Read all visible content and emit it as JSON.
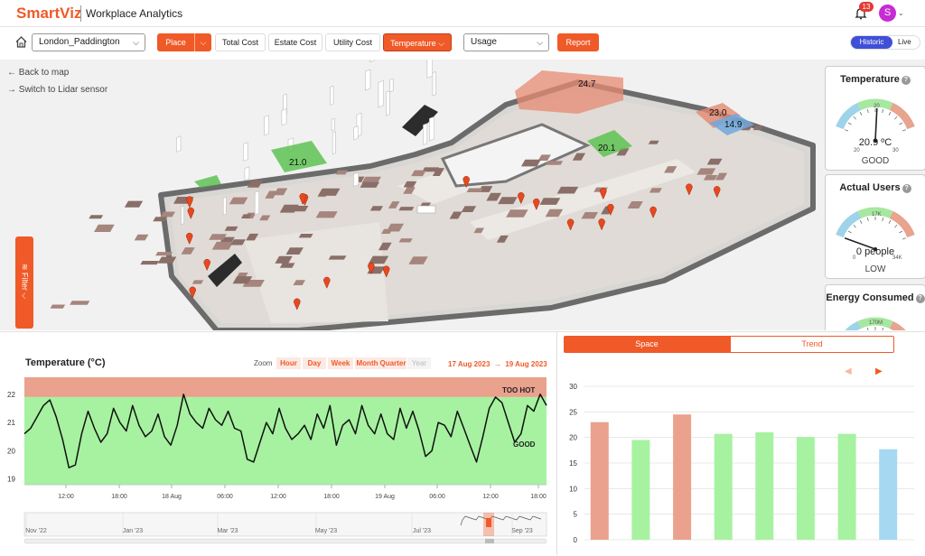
{
  "header": {
    "brand": "SmartViz",
    "product": "Workplace Analytics",
    "notifications": "13",
    "avatar": "S"
  },
  "toolbar": {
    "location": "London_Paddington",
    "place": "Place",
    "total_cost": "Total Cost",
    "estate_cost": "Estate Cost",
    "utility_cost": "Utility Cost",
    "temperature": "Temperature",
    "usage": "Usage",
    "report": "Report",
    "historic": "Historic",
    "live": "Live"
  },
  "map": {
    "back": "Back to map",
    "lidar": "Switch to Lidar sensor",
    "filter": "Filter",
    "zone_labels": [
      {
        "text": "21.0",
        "color": "#55c14a"
      },
      {
        "text": "20.1",
        "color": "#55c14a"
      },
      {
        "text": "24.7",
        "color": "#e58a71"
      },
      {
        "text": "23.0",
        "color": "#e58a71"
      },
      {
        "text": "14.9",
        "color": "#6fa8dc"
      }
    ]
  },
  "gauges": {
    "temperature": {
      "title": "Temperature",
      "value": "20.9 ºC",
      "status": "GOOD",
      "min": "20",
      "mid": "20",
      "max": "30",
      "fraction": 0.52
    },
    "users": {
      "title": "Actual Users",
      "value": "0 people",
      "status": "LOW",
      "min": "0",
      "mid": "17K",
      "max": "34K",
      "fraction": 0.0
    },
    "energy": {
      "title": "Energy Consumed",
      "mid": "170M"
    }
  },
  "temp_chart": {
    "title": "Temperature (°C)",
    "zoom_label": "Zoom",
    "zoom_options": [
      "Hour",
      "Day",
      "Week",
      "Month",
      "Quarter",
      "Year"
    ],
    "date_from": "17 Aug 2023",
    "arrow": "→",
    "date_to": "19 Aug 2023",
    "band_labels": {
      "hot": "TOO HOT",
      "good": "GOOD"
    },
    "navigator_labels": [
      "Nov '22",
      "Jan '23",
      "Mar '23",
      "May '23",
      "Jul '23",
      "Sep '23"
    ]
  },
  "space_card": {
    "tabs": {
      "space": "Space",
      "trend": "Trend"
    },
    "prev": "◀",
    "next": "▶"
  },
  "chart_data": [
    {
      "type": "line",
      "title": "Temperature (°C)",
      "ylim": [
        18.8,
        22.6
      ],
      "y_ticks": [
        19,
        20,
        21,
        22
      ],
      "x_ticks": [
        "12:00",
        "18:00",
        "18 Aug",
        "06:00",
        "12:00",
        "18:00",
        "19 Aug",
        "06:00",
        "12:00",
        "18:00"
      ],
      "bands": [
        {
          "label": "TOO HOT",
          "from": 21.9,
          "to": 22.6,
          "color": "#eaa18d"
        },
        {
          "label": "GOOD",
          "from": 18.8,
          "to": 21.9,
          "color": "#a6f2a0"
        }
      ],
      "series": [
        {
          "color": "#111111",
          "x": [
            0,
            0.6,
            1.2,
            1.8,
            2.4,
            3.0,
            3.6,
            4.2,
            4.8,
            5.4,
            6.0,
            6.6,
            7.2,
            7.8,
            8.4,
            9.0,
            9.6,
            10.2,
            10.8,
            11.4,
            12.0,
            12.6,
            13.2,
            13.8,
            14.4,
            15.0,
            15.6,
            16.2,
            16.8,
            17.4,
            18.0,
            18.6,
            19.2,
            19.8,
            20.4,
            21.0,
            21.6,
            22.2,
            22.8,
            23.4,
            24.0,
            24.6,
            25.2,
            25.8,
            26.4,
            27.0,
            27.6,
            28.2,
            28.8,
            29.4,
            30.0,
            30.6,
            31.2,
            31.8,
            32.4,
            33.0,
            33.6,
            34.2,
            34.8,
            35.4,
            36.0,
            36.6,
            37.2,
            37.8,
            38.4,
            39.0,
            39.6,
            40.2,
            40.8,
            41.4,
            42.0,
            42.6,
            43.2,
            43.8,
            44.4,
            45.0,
            45.6,
            46.2,
            46.8,
            47.4,
            48.0,
            48.6,
            49.2
          ],
          "y": [
            20.6,
            20.8,
            21.2,
            21.6,
            21.8,
            21.2,
            20.4,
            19.4,
            19.5,
            20.6,
            21.4,
            20.8,
            20.3,
            20.6,
            21.5,
            21.0,
            20.7,
            21.6,
            20.9,
            20.5,
            20.7,
            21.3,
            20.5,
            20.2,
            20.9,
            22.0,
            21.3,
            21.0,
            20.8,
            21.5,
            21.1,
            20.9,
            21.4,
            20.8,
            20.7,
            19.7,
            19.6,
            20.3,
            21.0,
            20.6,
            21.5,
            20.8,
            20.4,
            20.6,
            20.9,
            20.4,
            21.3,
            20.8,
            21.6,
            20.2,
            20.9,
            21.1,
            20.6,
            21.6,
            20.9,
            20.6,
            21.3,
            20.6,
            20.4,
            21.5,
            20.8,
            21.4,
            20.7,
            19.8,
            20.0,
            21.0,
            20.9,
            20.5,
            21.4,
            20.8,
            20.2,
            19.6,
            20.5,
            21.5,
            21.9,
            21.7,
            21.0,
            20.3,
            20.6,
            21.6,
            21.4,
            22.0,
            21.6
          ]
        }
      ]
    },
    {
      "type": "bar",
      "ylim": [
        0,
        30
      ],
      "y_ticks": [
        0,
        5,
        10,
        15,
        20,
        25,
        30
      ],
      "values": [
        23.0,
        19.5,
        24.5,
        20.7,
        21.0,
        20.1,
        20.7,
        17.7
      ],
      "colors": [
        "#eaa18d",
        "#a6f2a0",
        "#eaa18d",
        "#a6f2a0",
        "#a6f2a0",
        "#a6f2a0",
        "#a6f2a0",
        "#a6d8f2"
      ]
    }
  ]
}
